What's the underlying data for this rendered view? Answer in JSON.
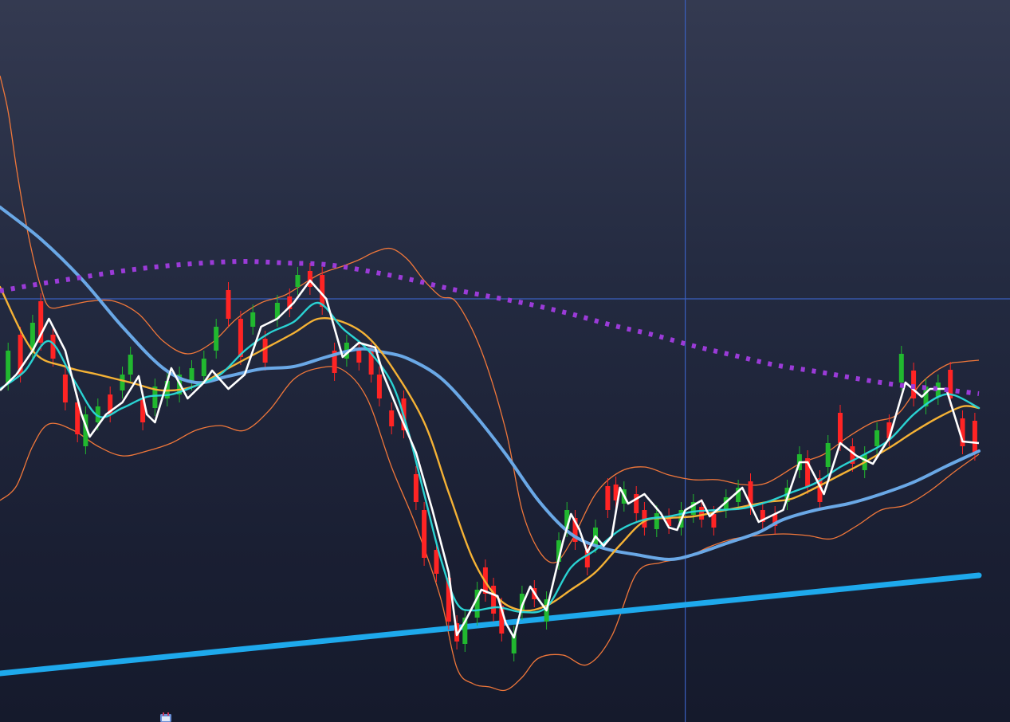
{
  "chart_data": {
    "type": "candlestick",
    "x_range": [
      0,
      240
    ],
    "y_range": [
      0,
      906
    ],
    "y_direction": "down",
    "grid": false,
    "legend": "none",
    "colors": {
      "background_top": "#343a51",
      "background_bottom": "#151a2c",
      "up": "#21b82f",
      "down": "#ff2424",
      "price_line": "#ffffff",
      "ma_fast": "#2ad3d3",
      "ma_mid": "#f5b235",
      "ma_slow": "#6aa8e6",
      "bollinger": "#f0773a",
      "trend": "#1ea9ec",
      "dotted_curve": "#9b3bd8",
      "crosshair": "#3a5fbf"
    },
    "crosshair": {
      "x": 168,
      "y": 375
    },
    "close": [
      [
        0,
        490
      ],
      [
        4,
        470
      ],
      [
        8,
        440
      ],
      [
        12,
        400
      ],
      [
        16,
        440
      ],
      [
        20,
        520
      ],
      [
        22,
        548
      ],
      [
        26,
        520
      ],
      [
        30,
        505
      ],
      [
        34,
        472
      ],
      [
        36,
        520
      ],
      [
        38,
        530
      ],
      [
        42,
        462
      ],
      [
        46,
        500
      ],
      [
        50,
        480
      ],
      [
        52,
        465
      ],
      [
        56,
        488
      ],
      [
        60,
        470
      ],
      [
        64,
        410
      ],
      [
        68,
        400
      ],
      [
        72,
        380
      ],
      [
        76,
        352
      ],
      [
        80,
        375
      ],
      [
        84,
        448
      ],
      [
        88,
        430
      ],
      [
        92,
        436
      ],
      [
        94,
        470
      ],
      [
        98,
        520
      ],
      [
        102,
        568
      ],
      [
        106,
        640
      ],
      [
        110,
        718
      ],
      [
        112,
        797
      ],
      [
        114,
        780
      ],
      [
        118,
        740
      ],
      [
        122,
        748
      ],
      [
        124,
        782
      ],
      [
        126,
        800
      ],
      [
        128,
        760
      ],
      [
        130,
        736
      ],
      [
        132,
        752
      ],
      [
        134,
        766
      ],
      [
        138,
        680
      ],
      [
        140,
        645
      ],
      [
        142,
        664
      ],
      [
        144,
        693
      ],
      [
        146,
        673
      ],
      [
        148,
        685
      ],
      [
        150,
        673
      ],
      [
        152,
        612
      ],
      [
        154,
        632
      ],
      [
        158,
        620
      ],
      [
        162,
        644
      ],
      [
        164,
        662
      ],
      [
        166,
        665
      ],
      [
        168,
        640
      ],
      [
        172,
        628
      ],
      [
        174,
        648
      ],
      [
        178,
        630
      ],
      [
        182,
        612
      ],
      [
        186,
        655
      ],
      [
        192,
        640
      ],
      [
        196,
        580
      ],
      [
        198,
        580
      ],
      [
        202,
        620
      ],
      [
        206,
        556
      ],
      [
        210,
        572
      ],
      [
        214,
        582
      ],
      [
        218,
        550
      ],
      [
        222,
        480
      ],
      [
        226,
        498
      ],
      [
        228,
        488
      ],
      [
        232,
        488
      ],
      [
        236,
        554
      ],
      [
        240,
        556
      ]
    ],
    "candles": [
      {
        "i": 2,
        "o": 480,
        "c": 440
      },
      {
        "i": 5,
        "o": 420,
        "c": 470
      },
      {
        "i": 8,
        "o": 440,
        "c": 405
      },
      {
        "i": 10,
        "o": 378,
        "c": 430
      },
      {
        "i": 13,
        "o": 420,
        "c": 450
      },
      {
        "i": 16,
        "o": 470,
        "c": 505
      },
      {
        "i": 19,
        "o": 505,
        "c": 545
      },
      {
        "i": 21,
        "o": 560,
        "c": 520
      },
      {
        "i": 24,
        "o": 530,
        "c": 510
      },
      {
        "i": 27,
        "o": 495,
        "c": 520
      },
      {
        "i": 30,
        "o": 490,
        "c": 470
      },
      {
        "i": 32,
        "o": 470,
        "c": 445
      },
      {
        "i": 35,
        "o": 500,
        "c": 530
      },
      {
        "i": 38,
        "o": 512,
        "c": 485
      },
      {
        "i": 41,
        "o": 500,
        "c": 478
      },
      {
        "i": 44,
        "o": 495,
        "c": 470
      },
      {
        "i": 47,
        "o": 480,
        "c": 462
      },
      {
        "i": 50,
        "o": 472,
        "c": 450
      },
      {
        "i": 53,
        "o": 440,
        "c": 410
      },
      {
        "i": 56,
        "o": 364,
        "c": 400
      },
      {
        "i": 59,
        "o": 400,
        "c": 448
      },
      {
        "i": 62,
        "o": 410,
        "c": 392
      },
      {
        "i": 65,
        "o": 425,
        "c": 455
      },
      {
        "i": 68,
        "o": 400,
        "c": 380
      },
      {
        "i": 71,
        "o": 372,
        "c": 388
      },
      {
        "i": 73,
        "o": 360,
        "c": 345
      },
      {
        "i": 76,
        "o": 340,
        "c": 360
      },
      {
        "i": 79,
        "o": 345,
        "c": 385
      },
      {
        "i": 82,
        "o": 440,
        "c": 468
      },
      {
        "i": 85,
        "o": 450,
        "c": 430
      },
      {
        "i": 88,
        "o": 438,
        "c": 455
      },
      {
        "i": 91,
        "o": 440,
        "c": 470
      },
      {
        "i": 93,
        "o": 470,
        "c": 500
      },
      {
        "i": 96,
        "o": 515,
        "c": 535
      },
      {
        "i": 99,
        "o": 500,
        "c": 540
      },
      {
        "i": 102,
        "o": 595,
        "c": 630
      },
      {
        "i": 104,
        "o": 640,
        "c": 700
      },
      {
        "i": 107,
        "o": 690,
        "c": 720
      },
      {
        "i": 110,
        "o": 725,
        "c": 780
      },
      {
        "i": 112,
        "o": 782,
        "c": 805
      },
      {
        "i": 114,
        "o": 808,
        "c": 775
      },
      {
        "i": 117,
        "o": 775,
        "c": 740
      },
      {
        "i": 119,
        "o": 712,
        "c": 745
      },
      {
        "i": 121,
        "o": 735,
        "c": 770
      },
      {
        "i": 123,
        "o": 760,
        "c": 795
      },
      {
        "i": 126,
        "o": 820,
        "c": 795
      },
      {
        "i": 128,
        "o": 768,
        "c": 745
      },
      {
        "i": 131,
        "o": 738,
        "c": 752
      },
      {
        "i": 134,
        "o": 780,
        "c": 752
      },
      {
        "i": 137,
        "o": 705,
        "c": 678
      },
      {
        "i": 139,
        "o": 664,
        "c": 640
      },
      {
        "i": 141,
        "o": 650,
        "c": 680
      },
      {
        "i": 144,
        "o": 690,
        "c": 712
      },
      {
        "i": 146,
        "o": 684,
        "c": 662
      },
      {
        "i": 149,
        "o": 610,
        "c": 640
      },
      {
        "i": 151,
        "o": 608,
        "c": 628
      },
      {
        "i": 153,
        "o": 632,
        "c": 614
      },
      {
        "i": 156,
        "o": 620,
        "c": 644
      },
      {
        "i": 158,
        "o": 640,
        "c": 662
      },
      {
        "i": 161,
        "o": 664,
        "c": 644
      },
      {
        "i": 164,
        "o": 648,
        "c": 660
      },
      {
        "i": 167,
        "o": 662,
        "c": 640
      },
      {
        "i": 170,
        "o": 646,
        "c": 630
      },
      {
        "i": 172,
        "o": 636,
        "c": 652
      },
      {
        "i": 175,
        "o": 645,
        "c": 662
      },
      {
        "i": 178,
        "o": 640,
        "c": 624
      },
      {
        "i": 181,
        "o": 630,
        "c": 612
      },
      {
        "i": 184,
        "o": 604,
        "c": 636
      },
      {
        "i": 187,
        "o": 640,
        "c": 655
      },
      {
        "i": 190,
        "o": 645,
        "c": 660
      },
      {
        "i": 193,
        "o": 630,
        "c": 612
      },
      {
        "i": 196,
        "o": 590,
        "c": 570
      },
      {
        "i": 198,
        "o": 575,
        "c": 610
      },
      {
        "i": 201,
        "o": 600,
        "c": 630
      },
      {
        "i": 203,
        "o": 586,
        "c": 556
      },
      {
        "i": 206,
        "o": 518,
        "c": 556
      },
      {
        "i": 209,
        "o": 560,
        "c": 582
      },
      {
        "i": 212,
        "o": 590,
        "c": 570
      },
      {
        "i": 215,
        "o": 560,
        "c": 540
      },
      {
        "i": 218,
        "o": 530,
        "c": 550
      },
      {
        "i": 221,
        "o": 480,
        "c": 444
      },
      {
        "i": 224,
        "o": 465,
        "c": 500
      },
      {
        "i": 227,
        "o": 510,
        "c": 485
      },
      {
        "i": 230,
        "o": 498,
        "c": 480
      },
      {
        "i": 233,
        "o": 464,
        "c": 500
      },
      {
        "i": 236,
        "o": 525,
        "c": 560
      },
      {
        "i": 239,
        "o": 528,
        "c": 568
      }
    ],
    "ma_fast": [
      [
        0,
        488
      ],
      [
        6,
        466
      ],
      [
        12,
        428
      ],
      [
        18,
        476
      ],
      [
        24,
        522
      ],
      [
        30,
        512
      ],
      [
        36,
        498
      ],
      [
        42,
        495
      ],
      [
        48,
        484
      ],
      [
        54,
        470
      ],
      [
        60,
        440
      ],
      [
        66,
        418
      ],
      [
        72,
        404
      ],
      [
        78,
        380
      ],
      [
        84,
        412
      ],
      [
        90,
        438
      ],
      [
        96,
        480
      ],
      [
        100,
        540
      ],
      [
        104,
        620
      ],
      [
        108,
        700
      ],
      [
        112,
        757
      ],
      [
        116,
        766
      ],
      [
        122,
        762
      ],
      [
        128,
        768
      ],
      [
        134,
        762
      ],
      [
        140,
        712
      ],
      [
        146,
        690
      ],
      [
        152,
        665
      ],
      [
        158,
        652
      ],
      [
        164,
        648
      ],
      [
        170,
        642
      ],
      [
        176,
        640
      ],
      [
        182,
        638
      ],
      [
        188,
        630
      ],
      [
        194,
        618
      ],
      [
        200,
        606
      ],
      [
        206,
        586
      ],
      [
        212,
        570
      ],
      [
        218,
        552
      ],
      [
        224,
        520
      ],
      [
        230,
        498
      ],
      [
        234,
        496
      ],
      [
        240,
        512
      ]
    ],
    "ma_mid": [
      [
        0,
        360
      ],
      [
        8,
        440
      ],
      [
        16,
        460
      ],
      [
        24,
        470
      ],
      [
        32,
        480
      ],
      [
        40,
        490
      ],
      [
        48,
        484
      ],
      [
        56,
        462
      ],
      [
        64,
        440
      ],
      [
        72,
        418
      ],
      [
        78,
        400
      ],
      [
        84,
        404
      ],
      [
        90,
        422
      ],
      [
        96,
        460
      ],
      [
        104,
        530
      ],
      [
        110,
        618
      ],
      [
        116,
        702
      ],
      [
        122,
        750
      ],
      [
        128,
        766
      ],
      [
        134,
        760
      ],
      [
        140,
        740
      ],
      [
        146,
        718
      ],
      [
        152,
        684
      ],
      [
        158,
        654
      ],
      [
        164,
        650
      ],
      [
        170,
        648
      ],
      [
        176,
        642
      ],
      [
        182,
        636
      ],
      [
        188,
        630
      ],
      [
        194,
        626
      ],
      [
        200,
        612
      ],
      [
        206,
        596
      ],
      [
        212,
        580
      ],
      [
        218,
        562
      ],
      [
        224,
        542
      ],
      [
        230,
        524
      ],
      [
        236,
        510
      ],
      [
        240,
        512
      ]
    ],
    "ma_slow": [
      [
        0,
        260
      ],
      [
        10,
        300
      ],
      [
        20,
        350
      ],
      [
        30,
        410
      ],
      [
        40,
        462
      ],
      [
        48,
        480
      ],
      [
        56,
        472
      ],
      [
        64,
        463
      ],
      [
        72,
        460
      ],
      [
        80,
        448
      ],
      [
        88,
        438
      ],
      [
        94,
        442
      ],
      [
        100,
        450
      ],
      [
        108,
        474
      ],
      [
        116,
        518
      ],
      [
        124,
        570
      ],
      [
        132,
        628
      ],
      [
        140,
        670
      ],
      [
        148,
        688
      ],
      [
        156,
        696
      ],
      [
        164,
        702
      ],
      [
        170,
        696
      ],
      [
        178,
        682
      ],
      [
        186,
        668
      ],
      [
        192,
        652
      ],
      [
        200,
        640
      ],
      [
        208,
        632
      ],
      [
        216,
        620
      ],
      [
        224,
        605
      ],
      [
        232,
        585
      ],
      [
        240,
        566
      ]
    ],
    "bb_upper": [
      [
        0,
        95
      ],
      [
        2,
        140
      ],
      [
        4,
        210
      ],
      [
        6,
        270
      ],
      [
        8,
        320
      ],
      [
        10,
        360
      ],
      [
        12,
        385
      ],
      [
        16,
        384
      ],
      [
        22,
        378
      ],
      [
        28,
        378
      ],
      [
        34,
        394
      ],
      [
        40,
        428
      ],
      [
        46,
        444
      ],
      [
        52,
        430
      ],
      [
        58,
        400
      ],
      [
        64,
        380
      ],
      [
        70,
        370
      ],
      [
        78,
        345
      ],
      [
        84,
        334
      ],
      [
        88,
        326
      ],
      [
        92,
        316
      ],
      [
        96,
        312
      ],
      [
        100,
        326
      ],
      [
        104,
        352
      ],
      [
        108,
        372
      ],
      [
        112,
        380
      ],
      [
        118,
        440
      ],
      [
        124,
        540
      ],
      [
        128,
        640
      ],
      [
        132,
        690
      ],
      [
        136,
        706
      ],
      [
        140,
        680
      ],
      [
        146,
        620
      ],
      [
        152,
        592
      ],
      [
        158,
        586
      ],
      [
        164,
        596
      ],
      [
        170,
        602
      ],
      [
        176,
        602
      ],
      [
        182,
        608
      ],
      [
        188,
        606
      ],
      [
        196,
        582
      ],
      [
        202,
        570
      ],
      [
        208,
        548
      ],
      [
        214,
        530
      ],
      [
        220,
        520
      ],
      [
        226,
        480
      ],
      [
        232,
        458
      ],
      [
        236,
        454
      ],
      [
        240,
        452
      ]
    ],
    "bb_lower": [
      [
        0,
        628
      ],
      [
        4,
        610
      ],
      [
        8,
        560
      ],
      [
        12,
        532
      ],
      [
        18,
        540
      ],
      [
        24,
        560
      ],
      [
        30,
        572
      ],
      [
        36,
        566
      ],
      [
        42,
        556
      ],
      [
        48,
        540
      ],
      [
        54,
        534
      ],
      [
        60,
        540
      ],
      [
        66,
        515
      ],
      [
        72,
        476
      ],
      [
        78,
        462
      ],
      [
        84,
        464
      ],
      [
        90,
        500
      ],
      [
        96,
        586
      ],
      [
        102,
        660
      ],
      [
        108,
        750
      ],
      [
        112,
        838
      ],
      [
        116,
        858
      ],
      [
        120,
        862
      ],
      [
        124,
        866
      ],
      [
        128,
        850
      ],
      [
        132,
        826
      ],
      [
        138,
        822
      ],
      [
        144,
        834
      ],
      [
        150,
        798
      ],
      [
        156,
        720
      ],
      [
        162,
        706
      ],
      [
        168,
        700
      ],
      [
        174,
        686
      ],
      [
        180,
        676
      ],
      [
        186,
        672
      ],
      [
        192,
        670
      ],
      [
        198,
        672
      ],
      [
        204,
        676
      ],
      [
        210,
        660
      ],
      [
        216,
        640
      ],
      [
        222,
        634
      ],
      [
        228,
        616
      ],
      [
        234,
        592
      ],
      [
        240,
        570
      ]
    ],
    "trend": [
      [
        0,
        845
      ],
      [
        240,
        722
      ]
    ],
    "dotted_curve": [
      [
        0,
        365
      ],
      [
        10,
        356
      ],
      [
        20,
        348
      ],
      [
        30,
        340
      ],
      [
        40,
        334
      ],
      [
        50,
        330
      ],
      [
        60,
        328
      ],
      [
        70,
        330
      ],
      [
        80,
        332
      ],
      [
        90,
        340
      ],
      [
        100,
        350
      ],
      [
        110,
        362
      ],
      [
        120,
        372
      ],
      [
        130,
        382
      ],
      [
        140,
        394
      ],
      [
        150,
        408
      ],
      [
        160,
        420
      ],
      [
        170,
        434
      ],
      [
        180,
        446
      ],
      [
        190,
        458
      ],
      [
        200,
        466
      ],
      [
        210,
        475
      ],
      [
        220,
        483
      ],
      [
        230,
        488
      ],
      [
        240,
        494
      ]
    ]
  }
}
